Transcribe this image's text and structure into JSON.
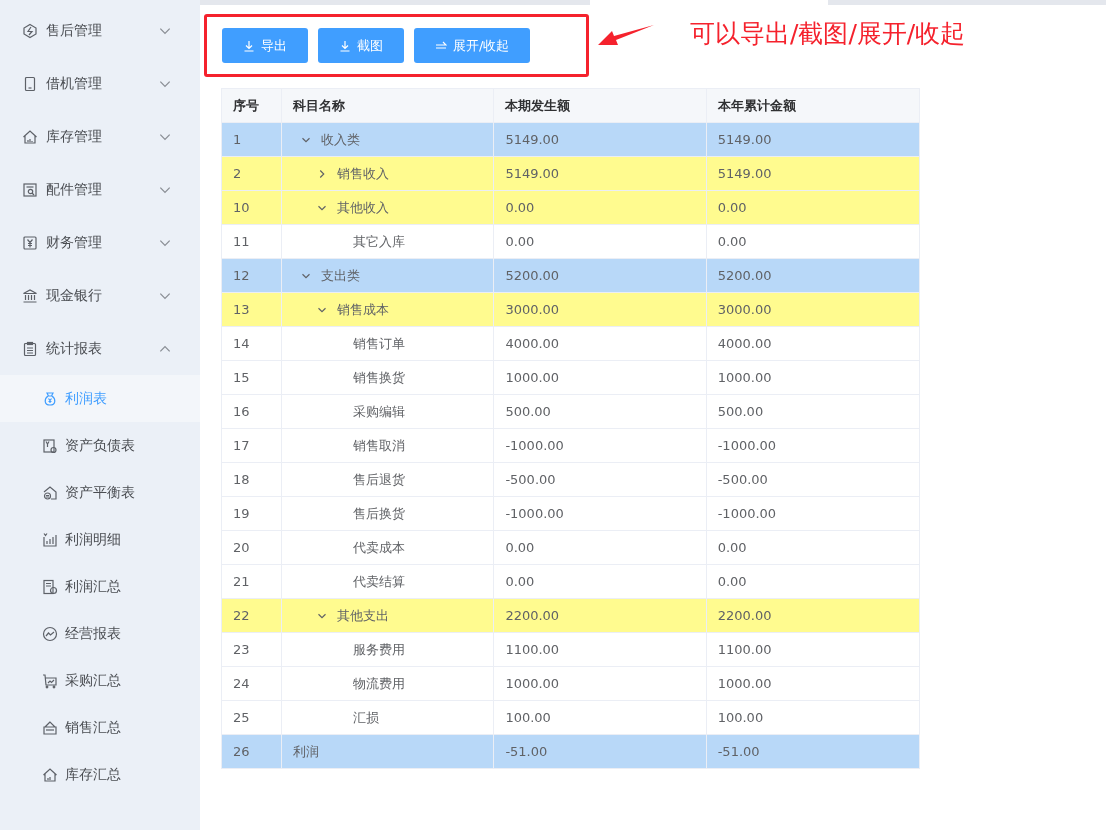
{
  "sidebar": {
    "items": [
      {
        "label": "售后管理",
        "expanded": false
      },
      {
        "label": "借机管理",
        "expanded": false
      },
      {
        "label": "库存管理",
        "expanded": false
      },
      {
        "label": "配件管理",
        "expanded": false
      },
      {
        "label": "财务管理",
        "expanded": false
      },
      {
        "label": "现金银行",
        "expanded": false
      },
      {
        "label": "统计报表",
        "expanded": true,
        "children": [
          {
            "label": "利润表",
            "selected": true
          },
          {
            "label": "资产负债表",
            "selected": false
          },
          {
            "label": "资产平衡表",
            "selected": false
          },
          {
            "label": "利润明细",
            "selected": false
          },
          {
            "label": "利润汇总",
            "selected": false
          },
          {
            "label": "经营报表",
            "selected": false
          },
          {
            "label": "采购汇总",
            "selected": false
          },
          {
            "label": "销售汇总",
            "selected": false
          },
          {
            "label": "库存汇总",
            "selected": false
          }
        ]
      }
    ]
  },
  "toolbar": {
    "buttons": [
      {
        "label": "导出",
        "kind": "download"
      },
      {
        "label": "截图",
        "kind": "download"
      },
      {
        "label": "展开/收起",
        "kind": "toggle"
      }
    ]
  },
  "annotation": {
    "text": "可以导出/截图/展开/收起"
  },
  "table": {
    "columns": [
      "序号",
      "科目名称",
      "本期发生额",
      "本年累计金额"
    ],
    "rows": [
      {
        "no": "1",
        "name": "收入类",
        "current": "5149.00",
        "ytd": "5149.00",
        "kind": "category",
        "expanded": true,
        "children": [
          {
            "no": "2",
            "name": "销售收入",
            "current": "5149.00",
            "ytd": "5149.00",
            "kind": "group",
            "expanded": false
          },
          {
            "no": "10",
            "name": "其他收入",
            "current": "0.00",
            "ytd": "0.00",
            "kind": "group",
            "expanded": true,
            "children": [
              {
                "no": "11",
                "name": "其它入库",
                "current": "0.00",
                "ytd": "0.00"
              }
            ]
          }
        ]
      },
      {
        "no": "12",
        "name": "支出类",
        "current": "5200.00",
        "ytd": "5200.00",
        "kind": "category",
        "expanded": true,
        "children": [
          {
            "no": "13",
            "name": "销售成本",
            "current": "3000.00",
            "ytd": "3000.00",
            "kind": "group",
            "expanded": true,
            "children": [
              {
                "no": "14",
                "name": "销售订单",
                "current": "4000.00",
                "ytd": "4000.00"
              },
              {
                "no": "15",
                "name": "销售换货",
                "current": "1000.00",
                "ytd": "1000.00"
              },
              {
                "no": "16",
                "name": "采购编辑",
                "current": "500.00",
                "ytd": "500.00"
              },
              {
                "no": "17",
                "name": "销售取消",
                "current": "-1000.00",
                "ytd": "-1000.00"
              },
              {
                "no": "18",
                "name": "售后退货",
                "current": "-500.00",
                "ytd": "-500.00"
              },
              {
                "no": "19",
                "name": "售后换货",
                "current": "-1000.00",
                "ytd": "-1000.00"
              },
              {
                "no": "20",
                "name": "代卖成本",
                "current": "0.00",
                "ytd": "0.00"
              },
              {
                "no": "21",
                "name": "代卖结算",
                "current": "0.00",
                "ytd": "0.00"
              }
            ]
          },
          {
            "no": "22",
            "name": "其他支出",
            "current": "2200.00",
            "ytd": "2200.00",
            "kind": "group",
            "expanded": true,
            "children": [
              {
                "no": "23",
                "name": "服务费用",
                "current": "1100.00",
                "ytd": "1100.00"
              },
              {
                "no": "24",
                "name": "物流费用",
                "current": "1000.00",
                "ytd": "1000.00"
              },
              {
                "no": "25",
                "name": "汇损",
                "current": "100.00",
                "ytd": "100.00"
              }
            ]
          }
        ]
      },
      {
        "no": "26",
        "label": "利润",
        "current": "-51.00",
        "ytd": "-51.00",
        "kind": "total"
      }
    ]
  }
}
